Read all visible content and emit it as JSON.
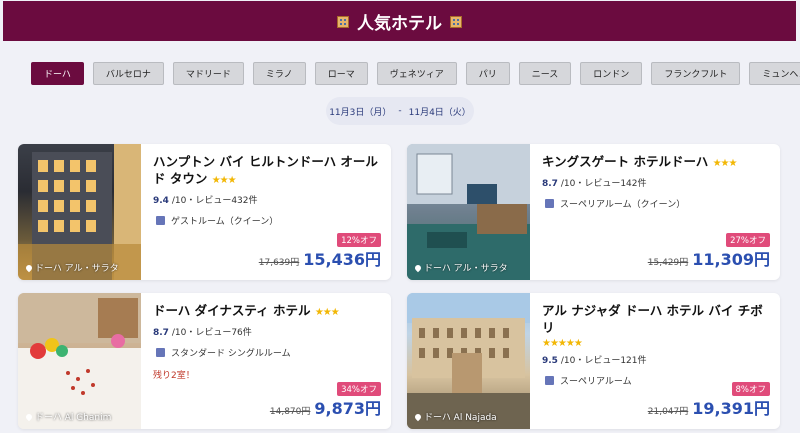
{
  "header": {
    "title": "人気ホテル",
    "icon": "hotel-icon"
  },
  "cities": [
    {
      "label": "ドーハ",
      "active": true
    },
    {
      "label": "バルセロナ"
    },
    {
      "label": "マドリード"
    },
    {
      "label": "ミラノ"
    },
    {
      "label": "ローマ"
    },
    {
      "label": "ヴェネツィア"
    },
    {
      "label": "パリ"
    },
    {
      "label": "ニース"
    },
    {
      "label": "ロンドン"
    },
    {
      "label": "フランクフルト"
    },
    {
      "label": "ミュンヘン"
    }
  ],
  "dates": {
    "checkin": "11月3日（月）",
    "sep": "-",
    "checkout": "11月4日（火）"
  },
  "hotels": [
    {
      "name": "ハンプトン バイ ヒルトンドーハ オールド タウン",
      "stars": "★★★",
      "score": "9.4",
      "score_suffix": "/10・レビュー432件",
      "room": "ゲストルーム（クイーン）",
      "availability": "",
      "discount": "12%オフ",
      "old_price": "17,639円",
      "price": "15,436円",
      "location": "ドーハ アル・サラタ"
    },
    {
      "name": "キングスゲート ホテルドーハ",
      "stars": "★★★",
      "score": "8.7",
      "score_suffix": "/10・レビュー142件",
      "room": "スーペリアルーム（クイーン）",
      "availability": "",
      "discount": "27%オフ",
      "old_price": "15,429円",
      "price": "11,309円",
      "location": "ドーハ アル・サラタ"
    },
    {
      "name": "ドーハ ダイナスティ ホテル",
      "stars": "★★★",
      "score": "8.7",
      "score_suffix": "/10・レビュー76件",
      "room": "スタンダード シングルルーム",
      "availability": "残り2室！",
      "discount": "34%オフ",
      "old_price": "14,870円",
      "price": "9,873円",
      "location": "ドーハ Al Ghanim"
    },
    {
      "name": "アル ナジャダ ドーハ ホテル バイ チボリ",
      "stars": "★★★★★",
      "score": "9.5",
      "score_suffix": "/10・レビュー121件",
      "room": "スーペリアルーム",
      "availability": "",
      "discount": "8%オフ",
      "old_price": "21,047円",
      "price": "19,391円",
      "location": "ドーハ Al Najada"
    }
  ]
}
